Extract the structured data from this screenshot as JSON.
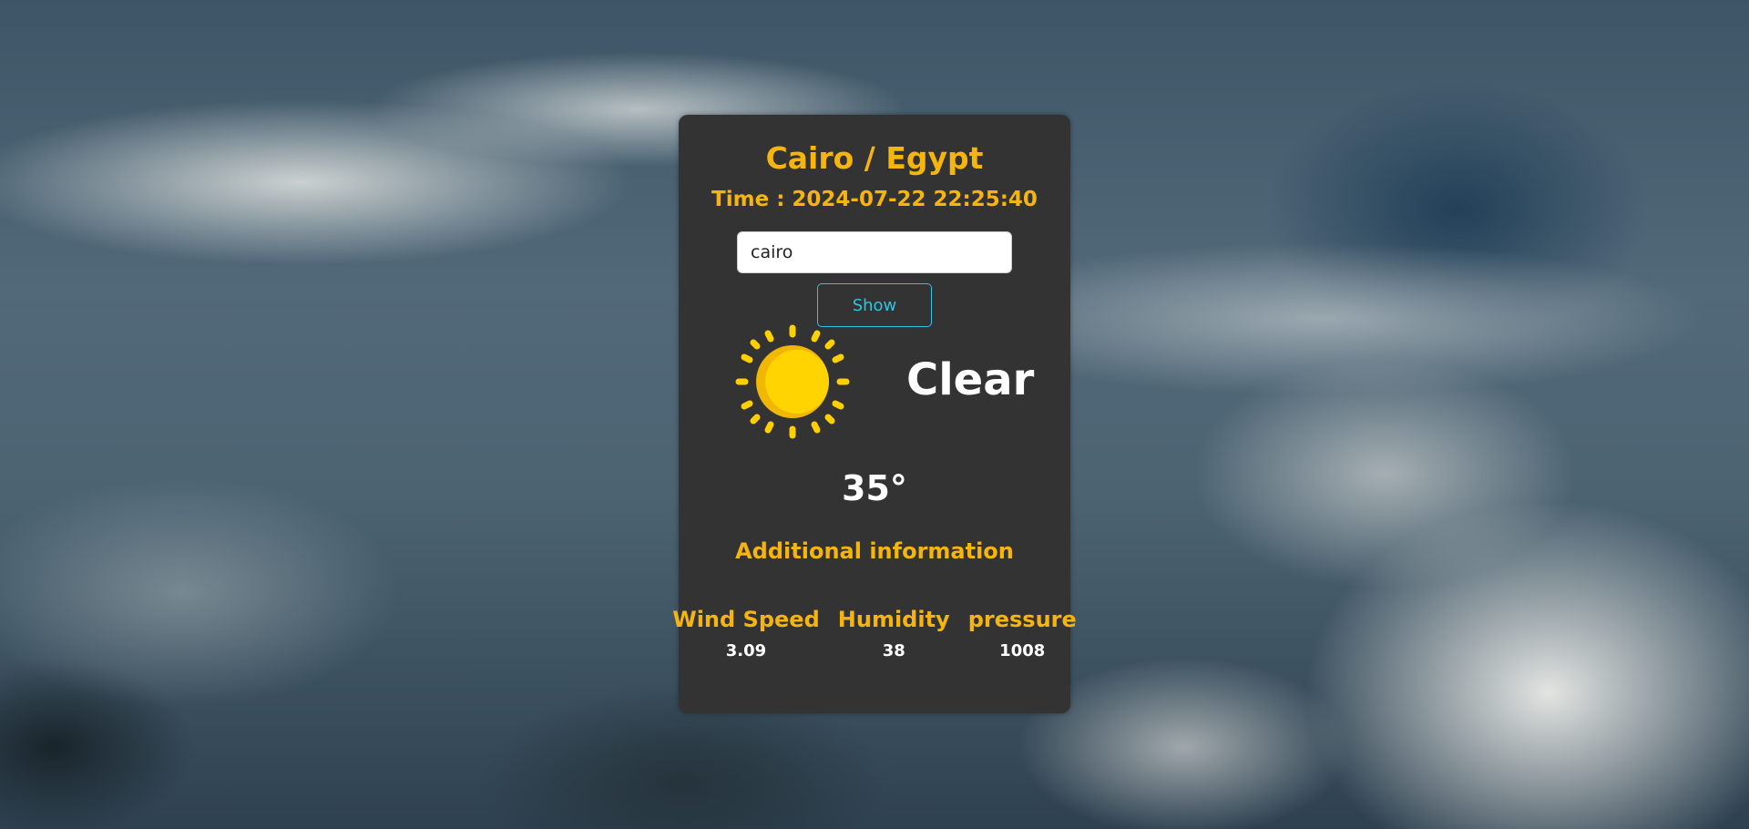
{
  "header": {
    "title": "Cairo / Egypt",
    "time": "Time : 2024-07-22 22:25:40"
  },
  "search": {
    "value": "cairo",
    "button_label": "Show"
  },
  "weather": {
    "icon": "sun-icon",
    "condition": "Clear",
    "temperature": "35°"
  },
  "additional": {
    "heading": "Additional information",
    "stats": [
      {
        "label": "Wind Speed",
        "value": "3.09"
      },
      {
        "label": "Humidity",
        "value": "38"
      },
      {
        "label": "pressure",
        "value": "1008"
      }
    ]
  },
  "colors": {
    "card_bg": "#333333",
    "accent": "#f5b50e",
    "button": "#2cc5e3",
    "sun": "#ffd000"
  }
}
